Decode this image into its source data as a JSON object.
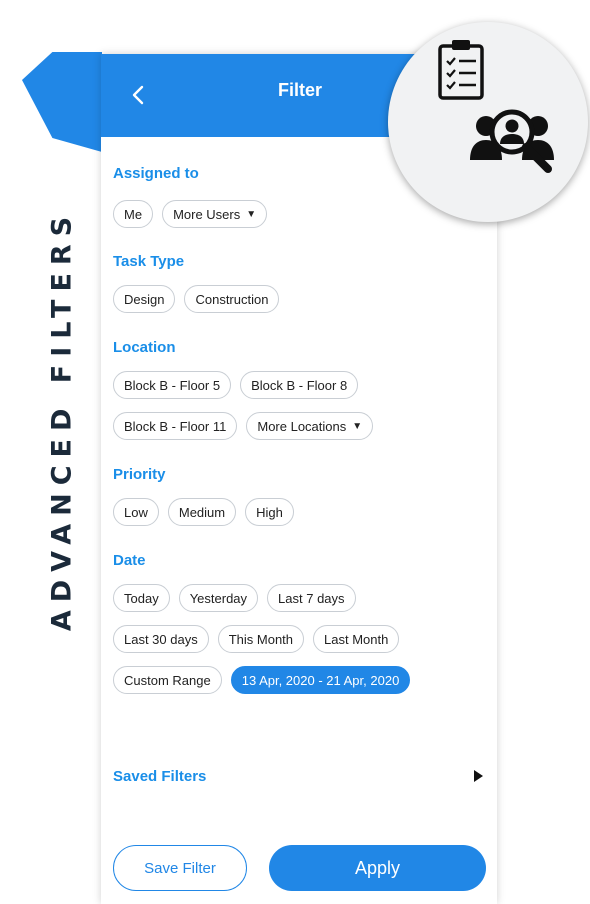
{
  "side_title": "ADVANCED FILTERS",
  "header": {
    "title": "Filter"
  },
  "sections": {
    "assigned_to": {
      "label": "Assigned to",
      "chips": [
        "Me",
        "More Users"
      ]
    },
    "task_type": {
      "label": "Task Type",
      "chips": [
        "Design",
        "Construction"
      ]
    },
    "location": {
      "label": "Location",
      "chips": [
        "Block B - Floor 5",
        "Block B - Floor 8",
        "Block B - Floor 11",
        "More Locations"
      ]
    },
    "priority": {
      "label": "Priority",
      "chips": [
        "Low",
        "Medium",
        "High"
      ]
    },
    "date": {
      "label": "Date",
      "chips": [
        "Today",
        "Yesterday",
        "Last 7 days",
        "Last 30 days",
        "This Month",
        "Last Month",
        "Custom Range",
        "13 Apr, 2020 - 21 Apr, 2020"
      ]
    }
  },
  "saved_filters": {
    "label": "Saved Filters"
  },
  "actions": {
    "save_label": "Save Filter",
    "apply_label": "Apply"
  },
  "colors": {
    "accent": "#2187e6",
    "heading": "#1a8ee8",
    "side_title": "#1b2a3a"
  },
  "icons": [
    "back-arrow-icon",
    "clipboard-checklist-icon",
    "user-search-icon",
    "caret-down-icon",
    "arrow-right-icon"
  ]
}
